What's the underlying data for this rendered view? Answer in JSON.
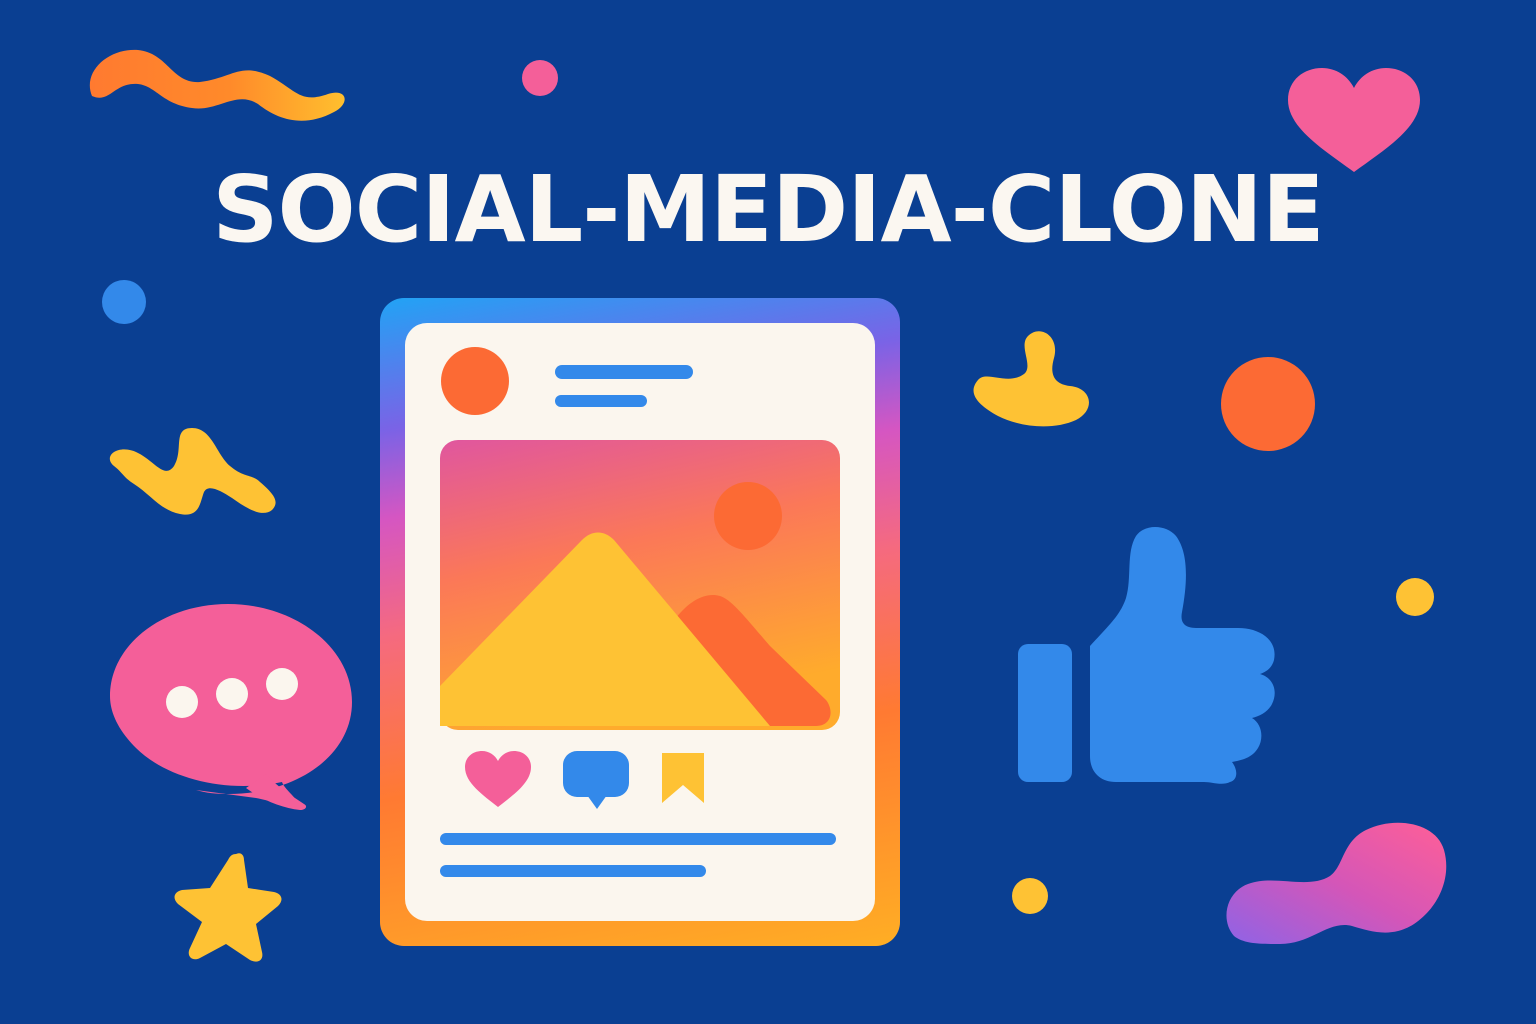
{
  "title": "SOCIAL-MEDIA-CLONE",
  "colors": {
    "background": "#0a3f92",
    "title_text": "#fbf7f1",
    "pink": "#f45f99",
    "orange": "#fc6a34",
    "yellow": "#fec234",
    "blue": "#3389ea",
    "card_surface": "#fbf6ee"
  },
  "post_card": {
    "avatar_icon": "avatar-circle",
    "image_icon": "landscape-image-icon",
    "actions": [
      {
        "icon": "heart-icon",
        "color": "#f45f99"
      },
      {
        "icon": "comment-icon",
        "color": "#3389ea"
      },
      {
        "icon": "bookmark-icon",
        "color": "#fec234"
      }
    ]
  },
  "decorations": [
    "squiggle-orange",
    "squiggle-yellow",
    "speech-bubble-icon",
    "star-icon",
    "thumbs-up-icon",
    "heart-icon",
    "blob-yellow",
    "blob-gradient",
    "dots"
  ]
}
